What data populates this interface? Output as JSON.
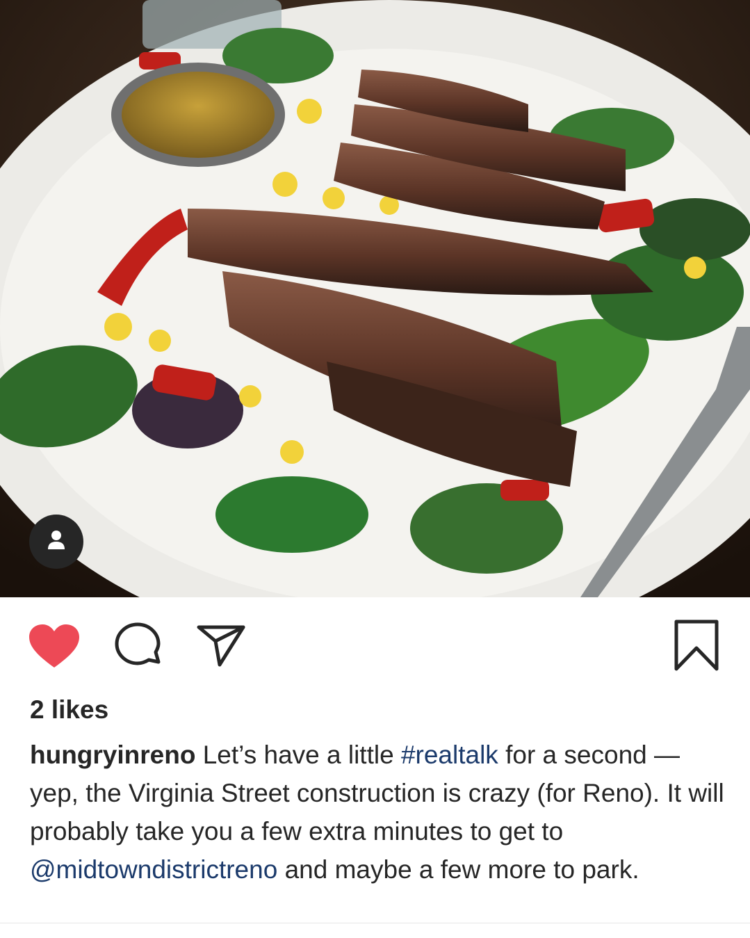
{
  "post": {
    "image_description": "",
    "likes_text": "2 likes",
    "caption": {
      "username": "hungryinreno",
      "text_1": " Let’s have a little ",
      "hashtag": "#realtalk",
      "text_2": " for a second — yep, the Virginia Street construction is crazy (for Reno). It will probably take you a few extra minutes to get to ",
      "mention": "@midtowndistrictreno",
      "text_3": " and maybe a few more to park."
    }
  },
  "icons": {
    "like": "heart-icon",
    "comment": "comment-icon",
    "share": "paper-plane-icon",
    "save": "bookmark-icon",
    "tag": "person-icon"
  },
  "colors": {
    "like_active": "#ed4956",
    "link": "#1b3a6b",
    "text": "#262626"
  }
}
